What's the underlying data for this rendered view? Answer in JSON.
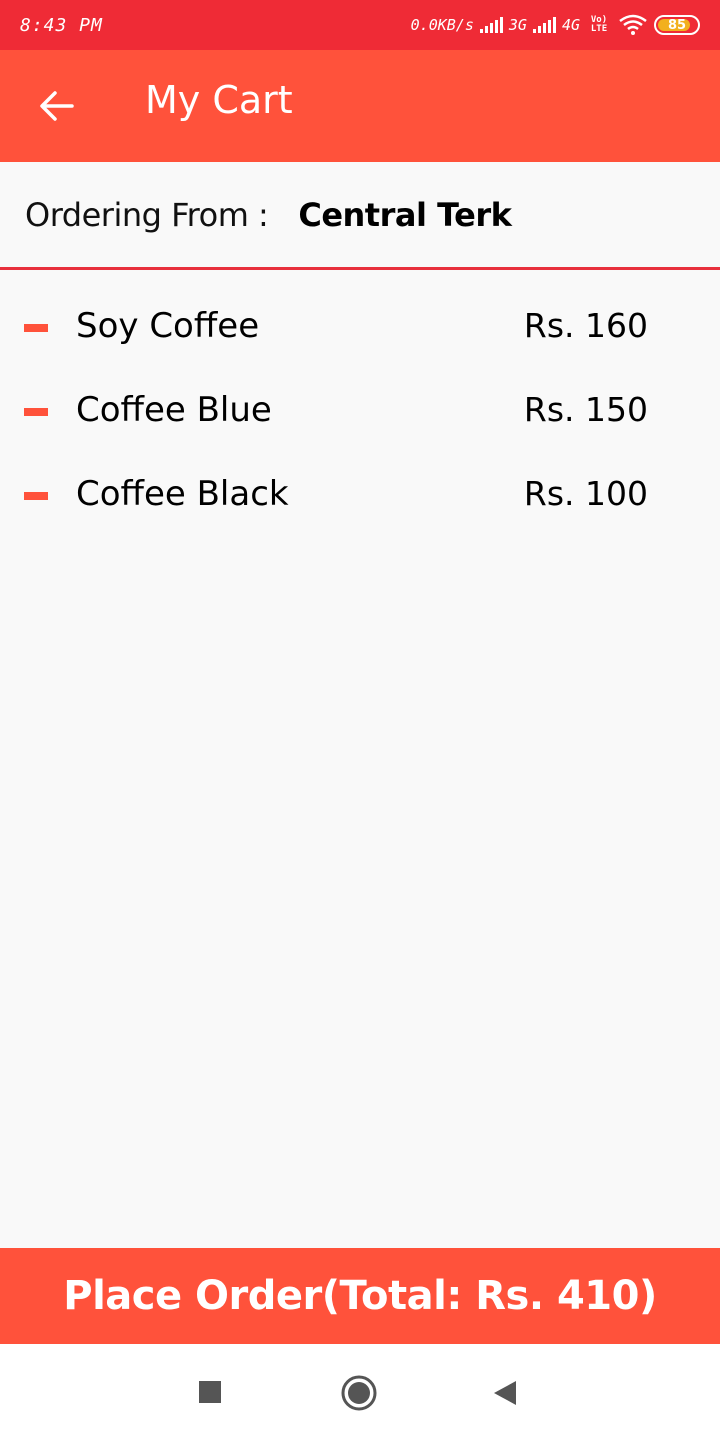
{
  "status_bar": {
    "time": "8:43 PM",
    "network_speed": "0.0KB/s",
    "sim1": "3G",
    "sim2": "4G",
    "volte": "Vo) LTE",
    "battery": "85",
    "battery_level": 0.85,
    "battery_color": "#f2b01e"
  },
  "app_bar": {
    "title": "My Cart",
    "back_icon": "arrow-back-icon",
    "color": "#ff523b"
  },
  "ordering": {
    "label": "Ordering From :",
    "store": "Central Terk"
  },
  "cart_items": [
    {
      "name": "Soy Coffee",
      "price": "Rs. 160"
    },
    {
      "name": "Coffee Blue",
      "price": "Rs. 150"
    },
    {
      "name": "Coffee Black",
      "price": "Rs. 100"
    }
  ],
  "place_order": {
    "label": "Place Order(Total: Rs. 410)"
  },
  "nav": {
    "recents_icon": "square-icon",
    "home_icon": "circle-icon",
    "back_icon": "triangle-back-icon"
  }
}
